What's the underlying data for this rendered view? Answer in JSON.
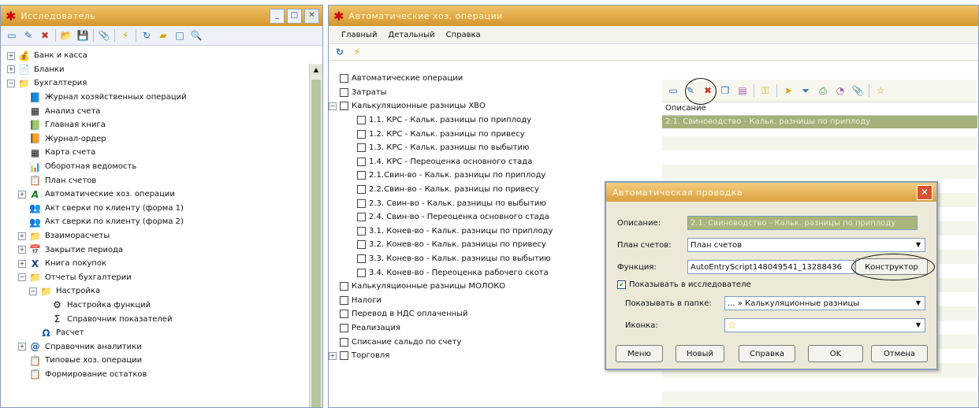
{
  "left_pane": {
    "title": "Исследователь",
    "window_buttons": [
      "_",
      "□",
      "✕"
    ],
    "toolbar_icons": [
      "new-icon",
      "edit-icon",
      "delete-icon",
      "open-folder-icon",
      "save-icon",
      "attach-icon",
      "lightning-icon",
      "refresh-icon",
      "folder-icon",
      "box-icon",
      "search-icon"
    ],
    "tree": [
      {
        "label": "Банк и касса",
        "indent": 0,
        "exp": "+",
        "icon": "bank-icon",
        "glyph": "💰"
      },
      {
        "label": "Бланки",
        "indent": 0,
        "exp": "+",
        "icon": "forms-icon",
        "glyph": "📄"
      },
      {
        "label": "Бухгалтерия",
        "indent": 0,
        "exp": "−",
        "icon": "folder-icon",
        "glyph": "📁"
      },
      {
        "label": "Журнал хозяйственных операций",
        "indent": 1,
        "exp": "",
        "icon": "journal-icon",
        "glyph": "📘"
      },
      {
        "label": "Анализ счета",
        "indent": 1,
        "exp": "",
        "icon": "analysis-icon",
        "glyph": "▦"
      },
      {
        "label": "Главная книга",
        "indent": 1,
        "exp": "",
        "icon": "book-icon",
        "glyph": "📗"
      },
      {
        "label": "Журнал-ордер",
        "indent": 1,
        "exp": "",
        "icon": "order-journal-icon",
        "glyph": "📙"
      },
      {
        "label": "Карта счета",
        "indent": 1,
        "exp": "",
        "icon": "card-icon",
        "glyph": "▦"
      },
      {
        "label": "Оборотная ведомость",
        "indent": 1,
        "exp": "",
        "icon": "statement-icon",
        "glyph": "📊"
      },
      {
        "label": "План счетов",
        "indent": 1,
        "exp": "",
        "icon": "accounts-plan-icon",
        "glyph": "📋"
      },
      {
        "label": "Автоматические хоз. операции",
        "indent": 1,
        "exp": "+",
        "icon": "auto-operations-icon",
        "glyph": "A"
      },
      {
        "label": "Акт сверки по клиенту (форма 1)",
        "indent": 1,
        "exp": "",
        "icon": "act-icon",
        "glyph": "👥"
      },
      {
        "label": "Акт сверки по клиенту (форма 2)",
        "indent": 1,
        "exp": "",
        "icon": "act-icon",
        "glyph": "👥"
      },
      {
        "label": "Взаиморасчеты",
        "indent": 1,
        "exp": "+",
        "icon": "folder-icon",
        "glyph": "📁"
      },
      {
        "label": "Закрытие периода",
        "indent": 1,
        "exp": "+",
        "icon": "period-close-icon",
        "glyph": "📅"
      },
      {
        "label": "Книга покупок",
        "indent": 1,
        "exp": "+",
        "icon": "purchase-book-icon",
        "glyph": "X"
      },
      {
        "label": "Отчеты бухгалтерии",
        "indent": 1,
        "exp": "−",
        "icon": "reports-icon",
        "glyph": "📁"
      },
      {
        "label": "Настройка",
        "indent": 2,
        "exp": "−",
        "icon": "settings-folder-icon",
        "glyph": "📁"
      },
      {
        "label": "Настройка функций",
        "indent": 3,
        "exp": "",
        "icon": "functions-icon",
        "glyph": "⚙"
      },
      {
        "label": "Справочник показателей",
        "indent": 3,
        "exp": "",
        "icon": "indicators-icon",
        "glyph": "Σ"
      },
      {
        "label": "Расчет",
        "indent": 2,
        "exp": "",
        "icon": "calculation-icon",
        "glyph": "Ω"
      },
      {
        "label": "Справочник аналитики",
        "indent": 1,
        "exp": "+",
        "icon": "analytics-icon",
        "glyph": "@"
      },
      {
        "label": "Типовые хоз. операции",
        "indent": 1,
        "exp": "",
        "icon": "typical-operations-icon",
        "glyph": "📋"
      },
      {
        "label": "Формирование остатков",
        "indent": 1,
        "exp": "",
        "icon": "balances-icon",
        "glyph": "📋"
      }
    ]
  },
  "right_pane": {
    "title": "Автоматические хоз. операции",
    "menu": [
      "Главный",
      "Детальный",
      "Справка"
    ],
    "toolbar_icons": [
      "refresh-icon",
      "lightning-icon"
    ],
    "tree": [
      {
        "label": "Автоматические операции",
        "indent": 0,
        "exp": ""
      },
      {
        "label": "Затраты",
        "indent": 0,
        "exp": ""
      },
      {
        "label": "Калькуляционные разницы ХВО",
        "indent": 0,
        "exp": "−"
      },
      {
        "label": "1.1. КРС - Кальк. разницы по приплоду",
        "indent": 1,
        "exp": ""
      },
      {
        "label": "1.2. КРС - Кальк. разницы по привесу",
        "indent": 1,
        "exp": ""
      },
      {
        "label": "1.3. КРС - Кальк. разницы по выбытию",
        "indent": 1,
        "exp": ""
      },
      {
        "label": "1.4. КРС - Переоценка основного стада",
        "indent": 1,
        "exp": ""
      },
      {
        "label": "2.1.Свин-во - Кальк. разницы по приплоду",
        "indent": 1,
        "exp": ""
      },
      {
        "label": "2.2.Свин-во - Кальк. разницы по привесу",
        "indent": 1,
        "exp": ""
      },
      {
        "label": "2.3. Свин-во - Кальк. разницы по выбытию",
        "indent": 1,
        "exp": ""
      },
      {
        "label": "2.4. Свин-во - Переоценка основного стада",
        "indent": 1,
        "exp": ""
      },
      {
        "label": "3.1. Конев-во - Кальк. разницы по приплоду",
        "indent": 1,
        "exp": ""
      },
      {
        "label": "3.2. Конев-во - Кальк. разницы по привесу",
        "indent": 1,
        "exp": ""
      },
      {
        "label": "3.3. Конев-во - Кальк. разницы по выбытию",
        "indent": 1,
        "exp": ""
      },
      {
        "label": "3.4. Конев-во - Переоценка рабочего скота",
        "indent": 1,
        "exp": ""
      },
      {
        "label": "Калькуляционные разницы МОЛОКО",
        "indent": 0,
        "exp": ""
      },
      {
        "label": "Налоги",
        "indent": 0,
        "exp": ""
      },
      {
        "label": "Перевод в НДС оплаченный",
        "indent": 0,
        "exp": ""
      },
      {
        "label": "Реализация",
        "indent": 0,
        "exp": ""
      },
      {
        "label": "Списание сальдо по счету",
        "indent": 0,
        "exp": ""
      },
      {
        "label": "Торговля",
        "indent": 0,
        "exp": "+"
      }
    ],
    "grid_toolbar_icons": [
      "new-icon",
      "edit-icon",
      "delete-icon",
      "copy-icon",
      "open-icon",
      "key-icon",
      "arrow-icon",
      "filter-icon",
      "print-icon",
      "chart-icon",
      "attach-icon",
      "star-icon"
    ],
    "grid": {
      "column": "Описание",
      "rows": [
        "2.1. Свиноводство - Кальк. разницы по приплоду"
      ]
    }
  },
  "dialog": {
    "title": "Автоматическая проводка",
    "description_label": "Описание:",
    "description_value": "2.1. Свиноводство - Кальк. разницы по приплоду",
    "plan_label": "План счетов:",
    "plan_value": "План счетов",
    "function_label": "Функция:",
    "function_value": "AutoEntryScript148049541_13288436",
    "constructor_button": "Конструктор",
    "show_checkbox_label": "Показывать в исследователе",
    "show_checkbox_checked": true,
    "folder_label": "Показывать в папке:",
    "folder_value": "... » Калькуляционные разницы",
    "icon_label": "Иконка:",
    "icon_value": "star-icon",
    "buttons": {
      "menu": "Меню",
      "new": "Новый",
      "help": "Справка",
      "ok": "OK",
      "cancel": "Отмена"
    }
  }
}
